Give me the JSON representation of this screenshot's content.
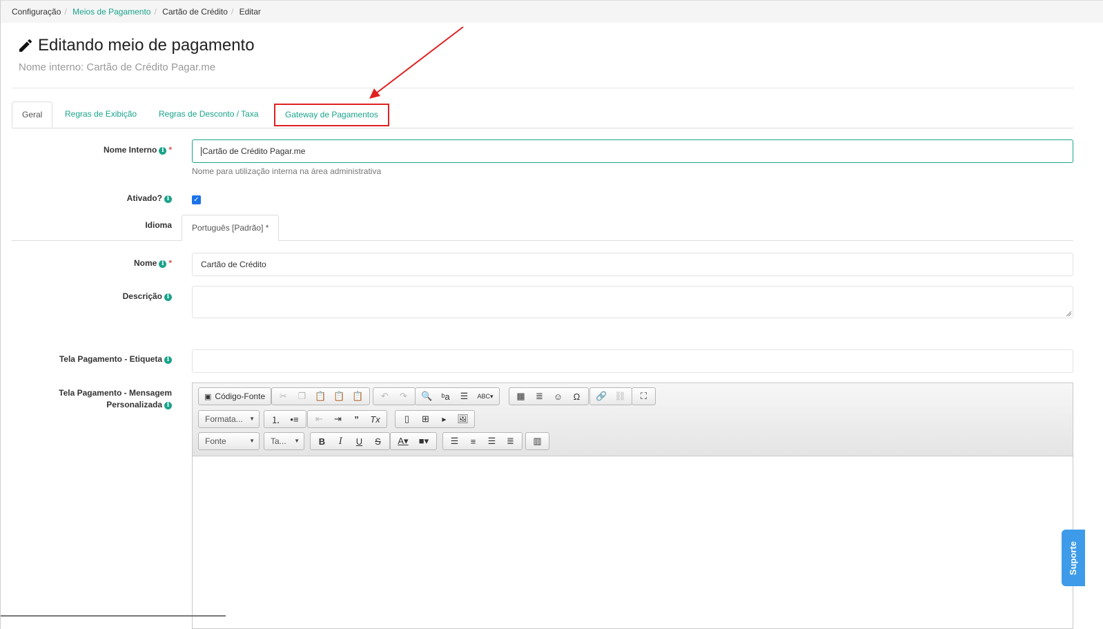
{
  "breadcrumb": {
    "items": [
      "Configuração",
      "Meios de Pagamento",
      "Cartão de Crédito",
      "Editar"
    ]
  },
  "header": {
    "title": "Editando meio de pagamento",
    "subtitle": "Nome interno: Cartão de Crédito Pagar.me"
  },
  "tabs": [
    "Geral",
    "Regras de Exibição",
    "Regras de Desconto / Taxa",
    "Gateway de Pagamentos"
  ],
  "form": {
    "nome_interno": {
      "label": "Nome Interno",
      "value": "Cartão de Crédito Pagar.me",
      "help": "Nome para utilização interna na área administrativa"
    },
    "ativado": {
      "label": "Ativado?"
    },
    "idioma": {
      "label": "Idioma",
      "tab": "Português [Padrão] *"
    },
    "nome": {
      "label": "Nome",
      "value": "Cartão de Crédito"
    },
    "descricao": {
      "label": "Descrição",
      "value": ""
    },
    "tela_etiqueta": {
      "label": "Tela Pagamento - Etiqueta",
      "value": ""
    },
    "tela_mensagem": {
      "label_line1": "Tela Pagamento - Mensagem",
      "label_line2": "Personalizada"
    }
  },
  "editor": {
    "source_label": "Código-Fonte",
    "format_label": "Formata...",
    "font_label": "Fonte",
    "size_label": "Ta..."
  },
  "support_label": "Suporte",
  "colors": {
    "accent": "#19a38a",
    "highlight": "#e02020",
    "support": "#3d9be9"
  }
}
